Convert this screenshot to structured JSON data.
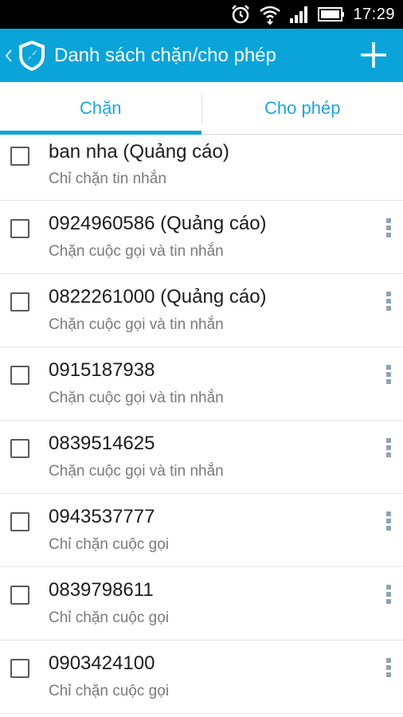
{
  "status_bar": {
    "time": "17:29",
    "icons": [
      "alarm-icon",
      "wifi-icon",
      "signal-icon",
      "battery-icon"
    ]
  },
  "app_bar": {
    "title": "Danh sách chặn/cho phép",
    "back_icon": "chevron-left-icon",
    "logo_icon": "shield-compass-icon",
    "add_icon": "plus-icon",
    "color": "#0aa4d9"
  },
  "tabs": [
    {
      "label": "Chặn",
      "active": true
    },
    {
      "label": "Cho phép",
      "active": false
    }
  ],
  "entries": [
    {
      "title": "ban nha (Quảng cáo)",
      "subtitle": "Chỉ chặn tin nhắn",
      "has_menu": false
    },
    {
      "title": "0924960586 (Quảng cáo)",
      "subtitle": "Chặn cuộc gọi và tin nhắn",
      "has_menu": true
    },
    {
      "title": "0822261000 (Quảng cáo)",
      "subtitle": "Chặn cuộc gọi và tin nhắn",
      "has_menu": true
    },
    {
      "title": "0915187938",
      "subtitle": "Chặn cuộc gọi và tin nhắn",
      "has_menu": true
    },
    {
      "title": "0839514625",
      "subtitle": "Chặn cuộc gọi và tin nhắn",
      "has_menu": true
    },
    {
      "title": "0943537777",
      "subtitle": "Chỉ chặn cuộc gọi",
      "has_menu": true
    },
    {
      "title": "0839798611",
      "subtitle": "Chỉ chặn cuộc gọi",
      "has_menu": true
    },
    {
      "title": "0903424100",
      "subtitle": "Chỉ chặn cuộc gọi",
      "has_menu": true
    }
  ]
}
